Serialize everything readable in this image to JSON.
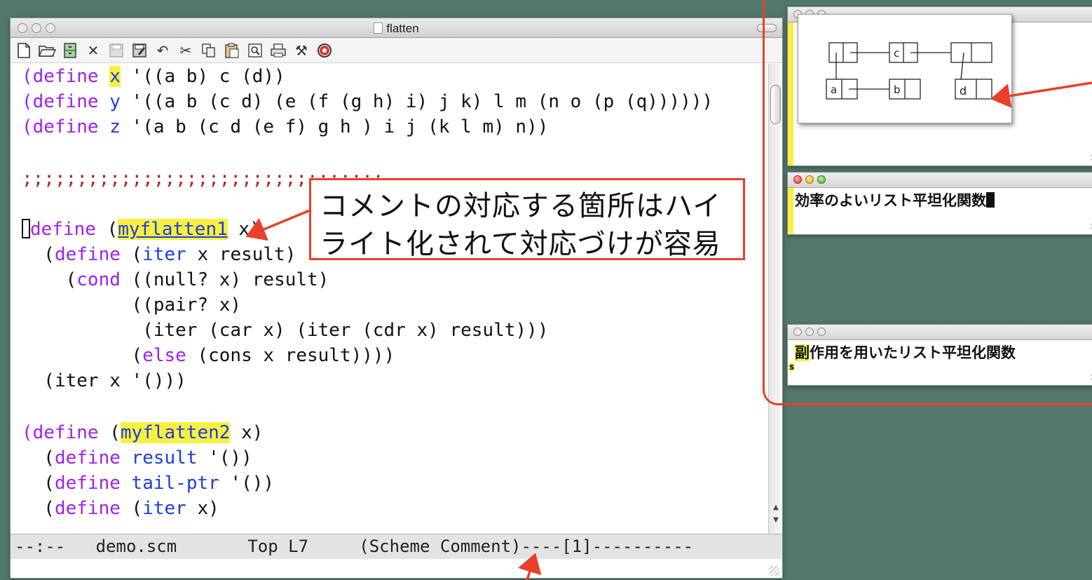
{
  "main_window": {
    "title": "flatten",
    "toolbar_icons": [
      "new-file-icon",
      "open-folder-icon",
      "cabinet-icon",
      "close-icon",
      "save-icon",
      "save-as-icon",
      "undo-icon",
      "cut-icon",
      "copy-icon",
      "paste-icon",
      "find-icon",
      "print-icon",
      "preferences-icon",
      "help-icon"
    ],
    "code": {
      "l1_define": "(define",
      "l1_var": "x",
      "l1_rest": " '((a b) c (d))",
      "l2_define": "(define",
      "l2_var": "y",
      "l2_rest": " '((a b (c d) (e (f (g h) i) j k) l m (n o (p (q))))))",
      "l3_define": "(define",
      "l3_var": "z",
      "l3_rest": " '(a b (c d (e f) g h ) i j (k l m) n))",
      "l5_comment": ";;;;;;;;;;;;;;;;;;;;;;;;;;;;;;;;;",
      "l6_define": "define",
      "l6_paren": " (",
      "l6_name": "myflatten1",
      "l6_rest": " x)",
      "l7_indent": "  (",
      "l7_define": "define",
      "l7_sp": " (",
      "l7_iter": "iter",
      "l7_rest": " x result)",
      "l8_indent": "    (",
      "l8_cond": "cond",
      "l8_rest": " ((null? x) result)",
      "l9": "          ((pair? x)",
      "l10": "           (iter (car x) (iter (cdr x) result)))",
      "l11_indent": "          (",
      "l11_else": "else",
      "l11_rest": " (cons x result))))",
      "l12": "  (iter x '()))",
      "l14_define": "(define",
      "l14_paren": " (",
      "l14_name": "myflatten2",
      "l14_rest": " x)",
      "l15_indent": "  (",
      "l15_define": "define",
      "l15_sp": " ",
      "l15_var": "result",
      "l15_rest": " '())",
      "l16_indent": "  (",
      "l16_define": "define",
      "l16_sp": " ",
      "l16_var": "tail-ptr",
      "l16_rest": " '())",
      "l17_indent": "  (",
      "l17_define": "define",
      "l17_sp": " (",
      "l17_iter": "iter",
      "l17_rest": " x)"
    },
    "modeline": "--:--   demo.scm       Top L7     (Scheme Comment)----[1]----------"
  },
  "diagram_window": {
    "cells": {
      "c": "c",
      "a": "a",
      "b": "b",
      "d": "d"
    }
  },
  "note_window_1": {
    "text": "効率のよいリスト平坦化関数"
  },
  "note_window_2": {
    "first_char": "副",
    "text": "作用を用いたリスト平坦化関数",
    "marker": "s"
  },
  "callout": {
    "line1": "コメントの対応する箇所はハイ",
    "line2": "ライト化されて対応づけが容易"
  },
  "colors": {
    "desktop": "#52786b",
    "annotation_red": "#e8402a",
    "highlight_yellow": "#f8f040",
    "keyword_purple": "#a020f0",
    "function_blue": "#1a3fd8",
    "comment_red": "#b22222"
  }
}
